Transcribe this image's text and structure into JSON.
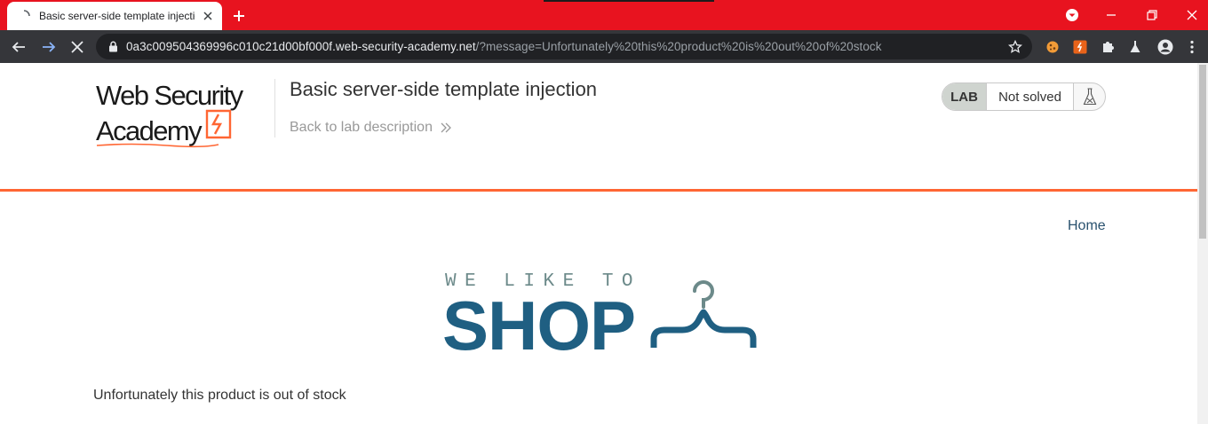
{
  "browser": {
    "tab_title": "Basic server-side template injection",
    "url_host": "0a3c009504369996c010c21d00bf000f.web-security-academy.net",
    "url_rest": "/?message=Unfortunately%20this%20product%20is%20out%20of%20stock",
    "accent_color": "#e8131f",
    "icons": [
      "back-arrow-icon",
      "forward-arrow-icon",
      "stop-loading-icon",
      "lock-icon",
      "star-icon",
      "extension-icons",
      "profile-icon",
      "kebab-menu-icon"
    ]
  },
  "header": {
    "logo_line1": "Web Security",
    "logo_line2": "Academy",
    "lab_title": "Basic server-side template injection",
    "back_link": "Back to lab description",
    "lab_badge": "LAB",
    "lab_status": "Not solved",
    "accent_color": "#ff6633"
  },
  "nav": {
    "home": "Home"
  },
  "shop_logo": {
    "tagline": "WE LIKE TO",
    "word": "SHOP"
  },
  "main": {
    "message": "Unfortunately this product is out of stock"
  }
}
